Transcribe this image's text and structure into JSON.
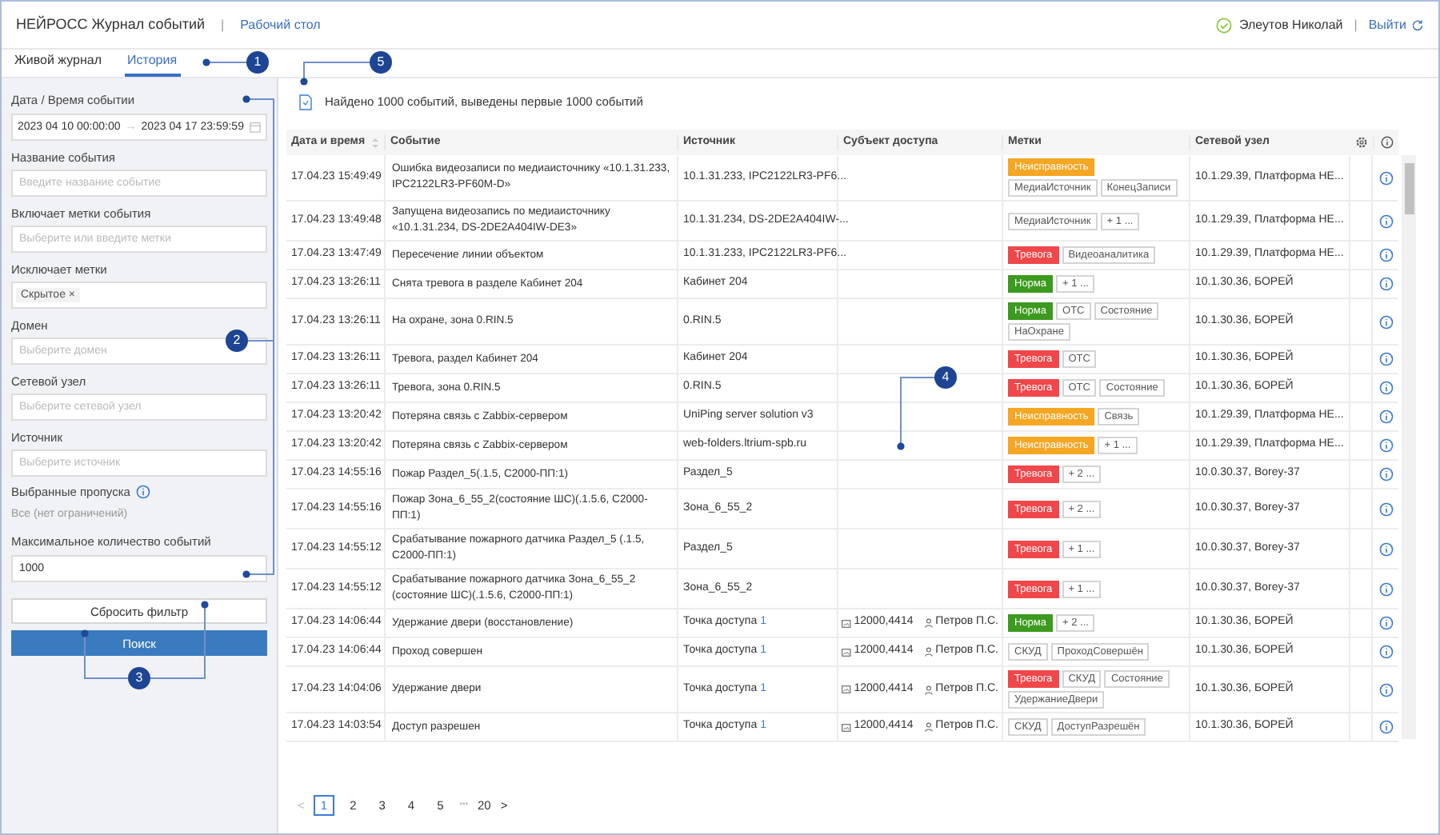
{
  "header": {
    "title": "НЕЙРОСС Журнал событий",
    "separator": "|",
    "link": "Рабочий стол",
    "user": "Элеутов Николай",
    "user_separator": "|",
    "logout": "Выйти"
  },
  "tabs": [
    {
      "label": "Живой журнал",
      "selected": false
    },
    {
      "label": "История",
      "selected": true
    }
  ],
  "filters": {
    "date_label": "Дата / Время событии",
    "date_from": "2023 04 10 00:00:00",
    "date_arrow": "→",
    "date_to": "2023 04 17 23:59:59",
    "fields": [
      {
        "label": "Название события",
        "placeholder": "Введите название событие"
      },
      {
        "label": "Включает метки события",
        "placeholder": "Выберите или введите метки"
      },
      {
        "label": "Исключает метки",
        "chip": "Скрытое",
        "chip_close": "×"
      },
      {
        "label": "Домен",
        "placeholder": "Выберите домен"
      },
      {
        "label": "Сетевой узел",
        "placeholder": "Выберите сетевой узел"
      },
      {
        "label": "Источник",
        "placeholder": "Выберите источник"
      }
    ],
    "passes_label": "Выбранные пропуска",
    "passes_value": "Все (нет ограничений)",
    "max_label": "Максимальное количество событий",
    "max_value": "1000",
    "reset": "Сбросить фильтр",
    "search": "Поиск"
  },
  "summary": "Найдено 1000 событий, выведены первые 1000 событий",
  "table": {
    "columns": [
      "Дата и время",
      "Событие",
      "Источник",
      "Субъект доступа",
      "Метки",
      "Сетевой узел"
    ],
    "rows": [
      {
        "time": "17.04.23 15:49:49",
        "event": "Ошибка видеозаписи по медиаисточнику «10.1.31.233, IPC2122LR3-PF60M-D»",
        "source": "10.1.31.233, IPC2122LR3-PF6...",
        "tags": [
          {
            "text": "Неисправность",
            "kind": "fault"
          },
          {
            "text": "МедиаИсточник",
            "kind": "plain"
          },
          {
            "text": "КонецЗаписи",
            "kind": "plain"
          }
        ],
        "node": "10.1.29.39, Платформа НЕ..."
      },
      {
        "time": "17.04.23 13:49:48",
        "event": "Запущена видеозапись по медиаисточнику «10.1.31.234, DS-2DE2A404IW-DE3»",
        "source": "10.1.31.234, DS-2DE2A404IW-...",
        "tags": [
          {
            "text": "МедиаИсточник",
            "kind": "plain"
          },
          {
            "text": "+ 1 ...",
            "kind": "plain"
          }
        ],
        "node": "10.1.29.39, Платформа НЕ..."
      },
      {
        "time": "17.04.23 13:47:49",
        "event": "Пересечение линии объектом",
        "source": "10.1.31.233, IPC2122LR3-PF6...",
        "tags": [
          {
            "text": "Тревога",
            "kind": "alarm"
          },
          {
            "text": "Видеоаналитика",
            "kind": "plain"
          }
        ],
        "node": "10.1.29.39, Платформа НЕ..."
      },
      {
        "time": "17.04.23 13:26:11",
        "event": "Снята тревога в разделе Кабинет 204",
        "source": "Кабинет 204",
        "tags": [
          {
            "text": "Норма",
            "kind": "norm"
          },
          {
            "text": "+ 1 ...",
            "kind": "plain"
          }
        ],
        "node": "10.1.30.36, БОРЕЙ"
      },
      {
        "time": "17.04.23 13:26:11",
        "event": "На охране, зона 0.RIN.5",
        "source": "0.RIN.5",
        "tags": [
          {
            "text": "Норма",
            "kind": "norm"
          },
          {
            "text": "ОТС",
            "kind": "plain"
          },
          {
            "text": "Состояние",
            "kind": "plain"
          },
          {
            "text": "НаОхране",
            "kind": "plain"
          }
        ],
        "node": "10.1.30.36, БОРЕЙ"
      },
      {
        "time": "17.04.23 13:26:11",
        "event": "Тревога, раздел Кабинет 204",
        "source": "Кабинет 204",
        "tags": [
          {
            "text": "Тревога",
            "kind": "alarm"
          },
          {
            "text": "ОТС",
            "kind": "plain"
          }
        ],
        "node": "10.1.30.36, БОРЕЙ"
      },
      {
        "time": "17.04.23 13:26:11",
        "event": "Тревога, зона 0.RIN.5",
        "source": "0.RIN.5",
        "tags": [
          {
            "text": "Тревога",
            "kind": "alarm"
          },
          {
            "text": "ОТС",
            "kind": "plain"
          },
          {
            "text": "Состояние",
            "kind": "plain"
          }
        ],
        "node": "10.1.30.36, БОРЕЙ"
      },
      {
        "time": "17.04.23 13:20:42",
        "event": "Потеряна связь с Zabbix-сервером",
        "source": "UniPing server solution v3",
        "tags": [
          {
            "text": "Неисправность",
            "kind": "fault"
          },
          {
            "text": "Связь",
            "kind": "plain"
          }
        ],
        "node": "10.1.29.39, Платформа НЕ..."
      },
      {
        "time": "17.04.23 13:20:42",
        "event": "Потеряна связь с Zabbix-сервером",
        "source": "web-folders.ltrium-spb.ru",
        "tags": [
          {
            "text": "Неисправность",
            "kind": "fault"
          },
          {
            "text": "+ 1 ...",
            "kind": "plain"
          }
        ],
        "node": "10.1.29.39, Платформа НЕ..."
      },
      {
        "time": "17.04.23 14:55:16",
        "event": "Пожар Раздел_5(.1.5, С2000-ПП:1)",
        "source": "Раздел_5",
        "tags": [
          {
            "text": "Тревога",
            "kind": "alarm"
          },
          {
            "text": "+ 2 ...",
            "kind": "plain"
          }
        ],
        "node": "10.0.30.37, Borey-37"
      },
      {
        "time": "17.04.23 14:55:16",
        "event": "Пожар Зона_6_55_2(состояние ШС)(.1.5.6, С2000-ПП:1)",
        "source": "Зона_6_55_2",
        "tags": [
          {
            "text": "Тревога",
            "kind": "alarm"
          },
          {
            "text": "+ 2 ...",
            "kind": "plain"
          }
        ],
        "node": "10.0.30.37, Borey-37"
      },
      {
        "time": "17.04.23 14:55:12",
        "event": "Срабатывание пожарного датчика Раздел_5 (.1.5, С2000-ПП:1)",
        "source": "Раздел_5",
        "tags": [
          {
            "text": "Тревога",
            "kind": "alarm"
          },
          {
            "text": "+ 1 ...",
            "kind": "plain"
          }
        ],
        "node": "10.0.30.37, Borey-37"
      },
      {
        "time": "17.04.23 14:55:12",
        "event": "Срабатывание пожарного датчика Зона_6_55_2 (состояние ШС)(.1.5.6, С2000-ПП:1)",
        "source": "Зона_6_55_2",
        "tags": [
          {
            "text": "Тревога",
            "kind": "alarm"
          },
          {
            "text": "+ 1 ...",
            "kind": "plain"
          }
        ],
        "node": "10.0.30.37, Borey-37"
      },
      {
        "time": "17.04.23 14:06:44",
        "event": "Удержание двери (восстановление)",
        "source": "Точка доступа",
        "source_link": "1",
        "card": "12000,4414",
        "person": "Петров П.С.",
        "tags": [
          {
            "text": "Норма",
            "kind": "norm"
          },
          {
            "text": "+ 2 ...",
            "kind": "plain"
          }
        ],
        "node": "10.1.30.36, БОРЕЙ"
      },
      {
        "time": "17.04.23 14:06:44",
        "event": "Проход совершен",
        "source": "Точка доступа",
        "source_link": "1",
        "card": "12000,4414",
        "person": "Петров П.С.",
        "tags": [
          {
            "text": "СКУД",
            "kind": "plain"
          },
          {
            "text": "ПроходСовершён",
            "kind": "plain"
          }
        ],
        "node": "10.1.30.36, БОРЕЙ"
      },
      {
        "time": "17.04.23 14:04:06",
        "event": "Удержание двери",
        "source": "Точка доступа",
        "source_link": "1",
        "card": "12000,4414",
        "person": "Петров П.С.",
        "tags": [
          {
            "text": "Тревога",
            "kind": "alarm"
          },
          {
            "text": "СКУД",
            "kind": "plain"
          },
          {
            "text": "Состояние",
            "kind": "plain"
          },
          {
            "text": "УдержаниеДвери",
            "kind": "plain"
          }
        ],
        "node": "10.1.30.36, БОРЕЙ"
      },
      {
        "time": "17.04.23 14:03:54",
        "event": "Доступ разрешен",
        "source": "Точка доступа",
        "source_link": "1",
        "card": "12000,4414",
        "person": "Петров П.С.",
        "tags": [
          {
            "text": "СКУД",
            "kind": "plain"
          },
          {
            "text": "ДоступРазрешён",
            "kind": "plain"
          }
        ],
        "node": "10.1.30.36, БОРЕЙ"
      }
    ]
  },
  "pagination": {
    "prev": "<",
    "pages": [
      {
        "label": "1",
        "selected": true
      },
      {
        "label": "2",
        "selected": false
      },
      {
        "label": "3",
        "selected": false
      },
      {
        "label": "4",
        "selected": false
      },
      {
        "label": "5",
        "selected": false
      }
    ],
    "ellipsis": "•••",
    "last": "20",
    "next": ">"
  },
  "callouts": [
    {
      "label": "1"
    },
    {
      "label": "2"
    },
    {
      "label": "3"
    },
    {
      "label": "4"
    },
    {
      "label": "5"
    }
  ]
}
